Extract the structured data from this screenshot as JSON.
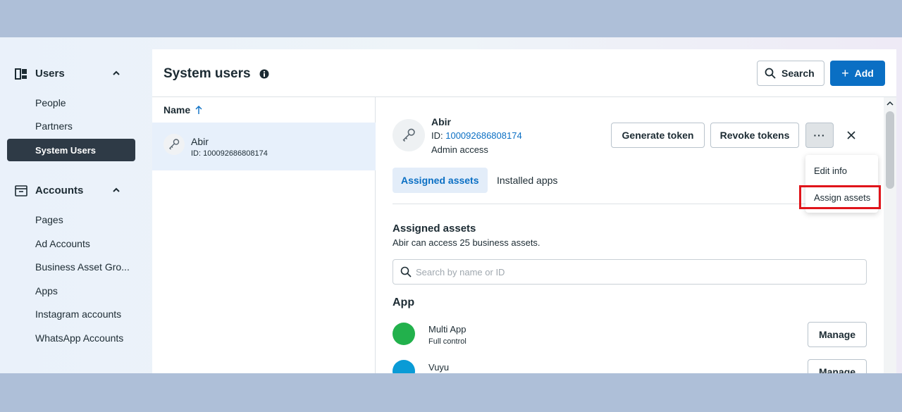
{
  "sidebar": {
    "sections": [
      {
        "label": "Users",
        "icon": "users-icon",
        "items": [
          "People",
          "Partners",
          "System Users"
        ],
        "active": "System Users"
      },
      {
        "label": "Accounts",
        "icon": "accounts-icon",
        "items": [
          "Pages",
          "Ad Accounts",
          "Business Asset Gro...",
          "Apps",
          "Instagram accounts",
          "WhatsApp Accounts"
        ]
      }
    ]
  },
  "header": {
    "title": "System users",
    "search_label": "Search",
    "add_label": "Add"
  },
  "list": {
    "column_header": "Name",
    "rows": [
      {
        "name": "Abir",
        "id": "ID: 100092686808174"
      }
    ]
  },
  "detail": {
    "name": "Abir",
    "id_prefix": "ID: ",
    "id_value": "100092686808174",
    "access": "Admin access",
    "generate_token": "Generate token",
    "revoke_tokens": "Revoke tokens",
    "more_label": "···",
    "tabs": [
      "Assigned assets",
      "Installed apps"
    ],
    "section_title": "Assigned assets",
    "section_subtitle": "Abir can access 25 business assets.",
    "search_placeholder": "Search by name or ID",
    "app_heading": "App",
    "apps": [
      {
        "name": "Multi App",
        "access": "Full control",
        "color": "#22b14c",
        "manage": "Manage"
      },
      {
        "name": "Vuyu",
        "access": "",
        "color": "#0a9bd6",
        "manage": "Manage"
      }
    ]
  },
  "dropdown": {
    "items": [
      "Edit info",
      "Assign assets"
    ],
    "highlight_color": "#e0141a"
  }
}
